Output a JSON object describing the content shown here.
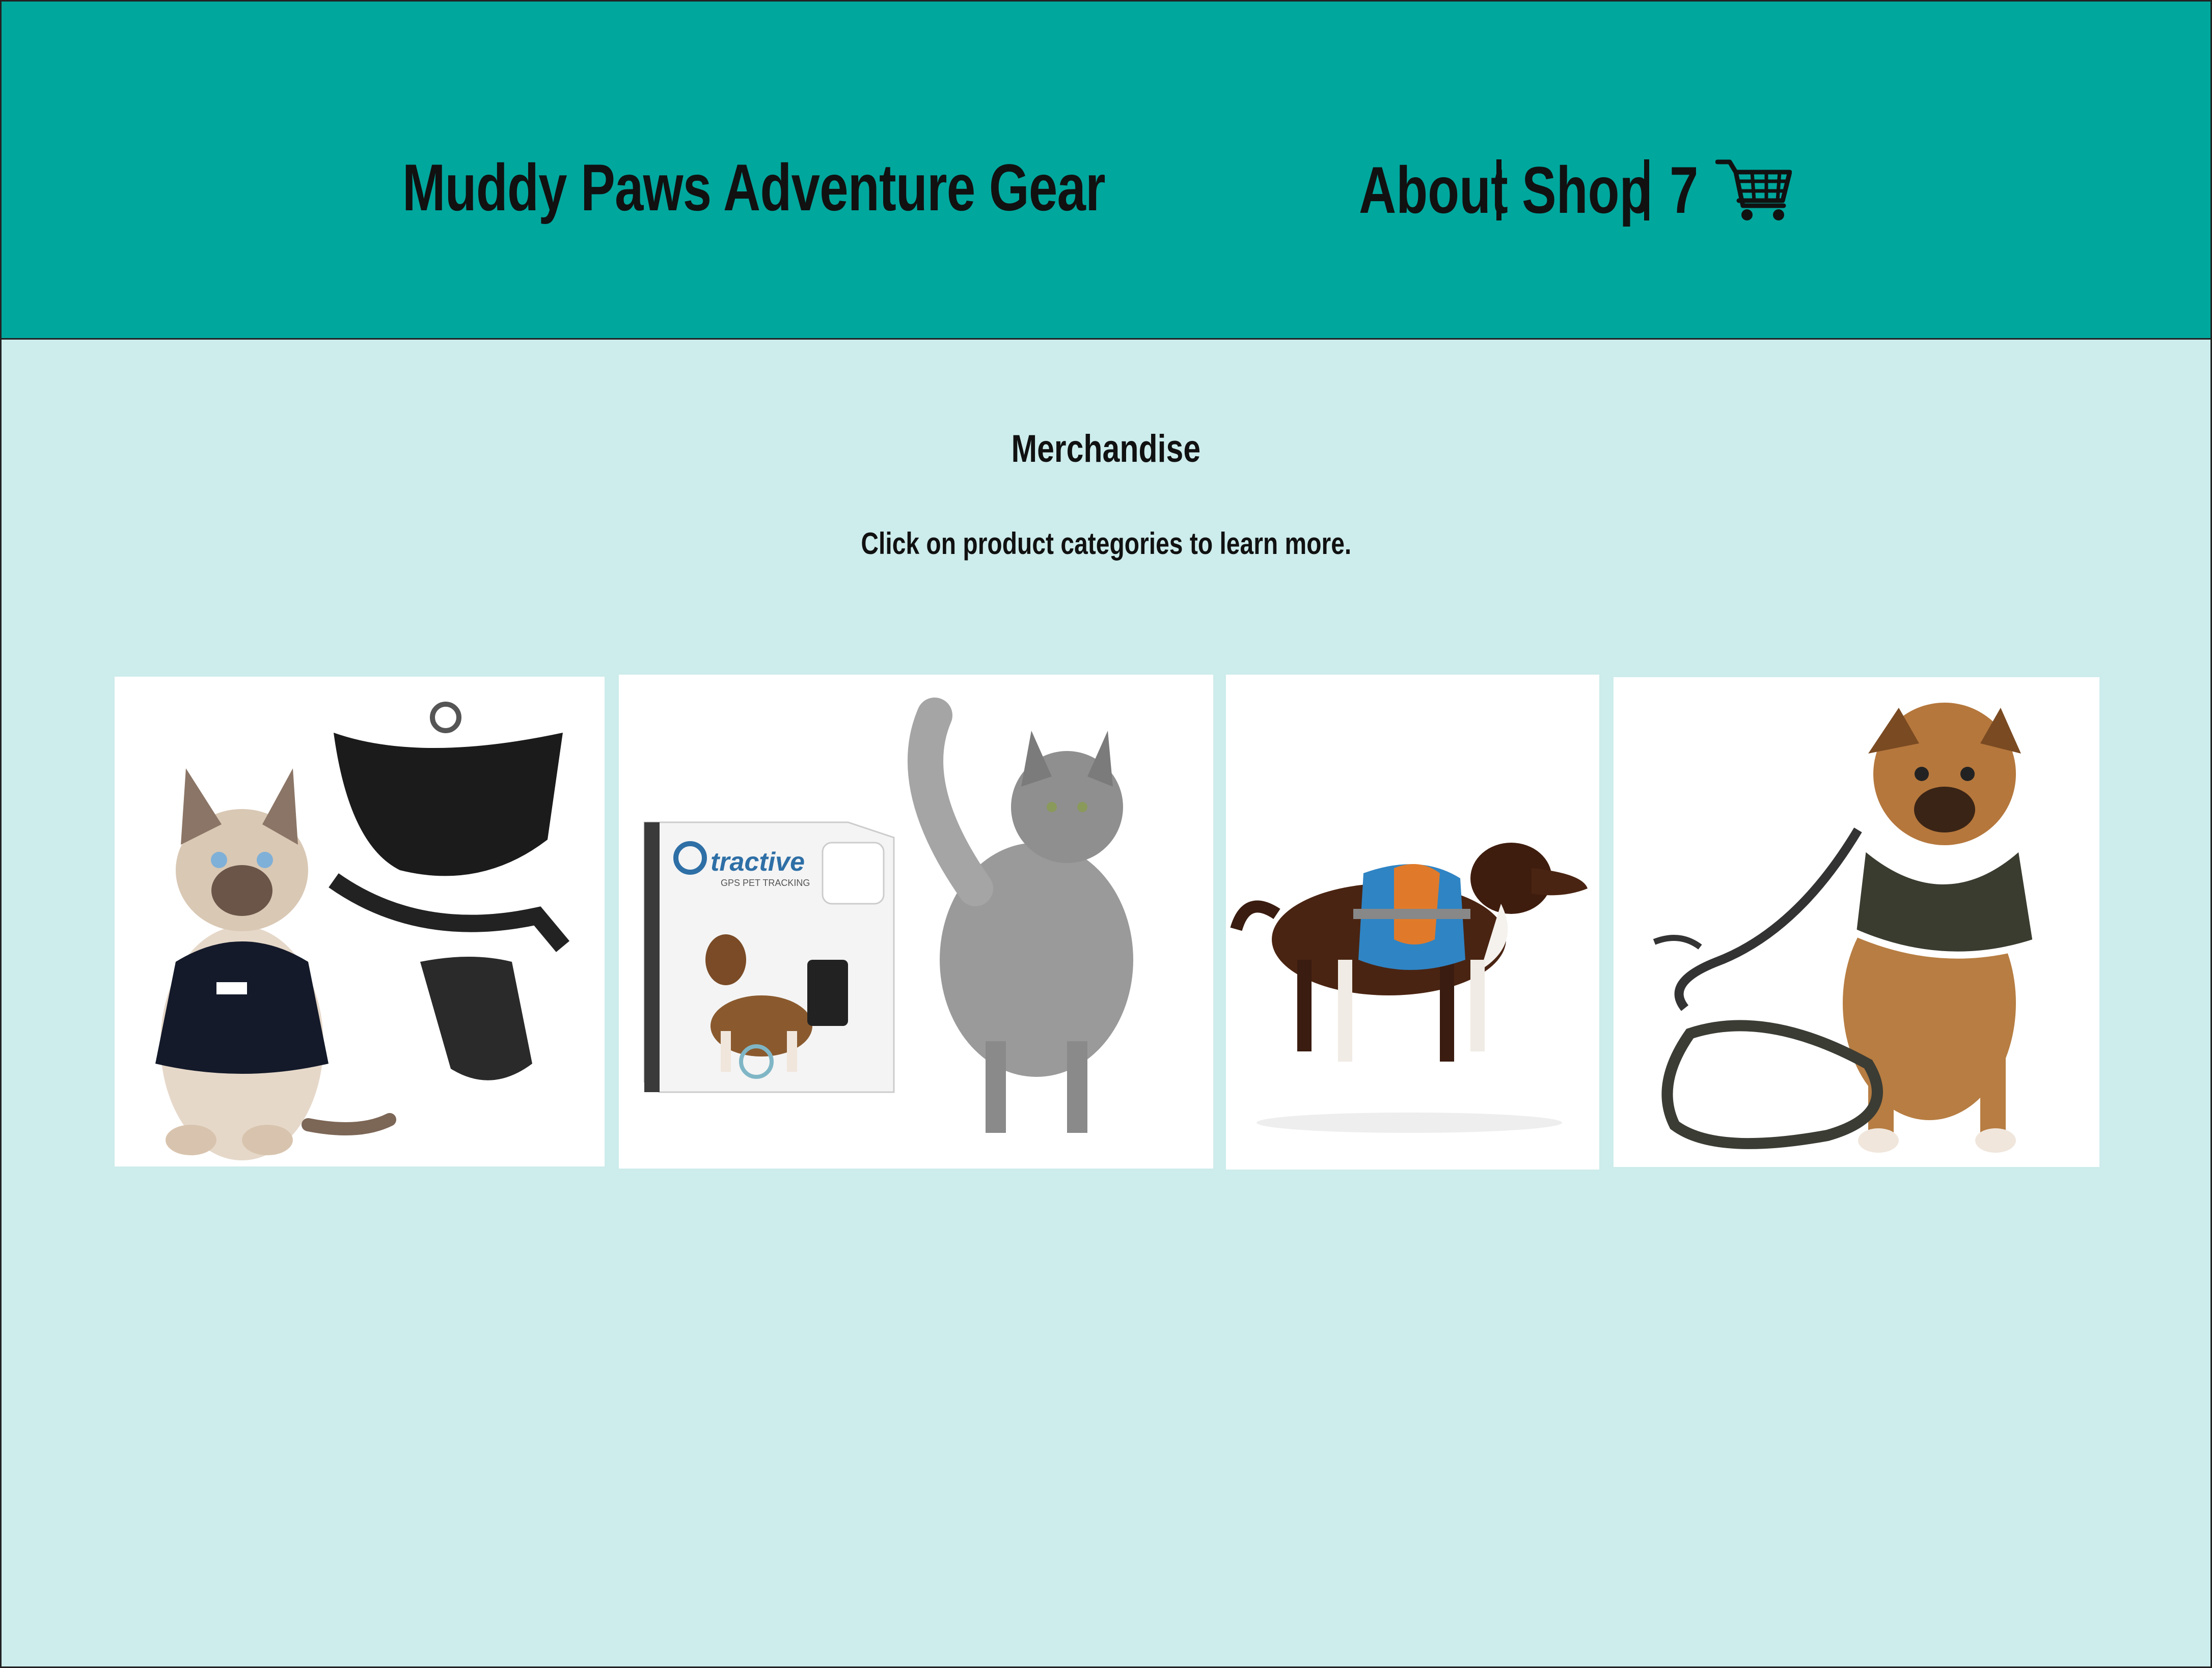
{
  "header": {
    "brand": "Muddy Paws Adventure Gear",
    "nav": {
      "about": "About",
      "shop": "Shop",
      "cart_count": "7"
    },
    "cart_icon": "shopping-cart-icon"
  },
  "main": {
    "title": "Merchandise",
    "subtitle": "Click on product categories to learn more."
  },
  "products": [
    {
      "name": "cat-harness",
      "image": "cat wearing harness with harness views"
    },
    {
      "name": "gps-tracker",
      "image": "tractive GPS tracker box with cat",
      "box_brand": "tractive",
      "box_caption": "GPS PET TRACKING"
    },
    {
      "name": "dog-backpack",
      "image": "dog wearing saddlebag backpack"
    },
    {
      "name": "dog-harness-leash",
      "image": "puppy wearing harness with leash"
    }
  ],
  "colors": {
    "header_bg": "#00a79d",
    "page_bg": "#cdecec",
    "text": "#111111"
  }
}
